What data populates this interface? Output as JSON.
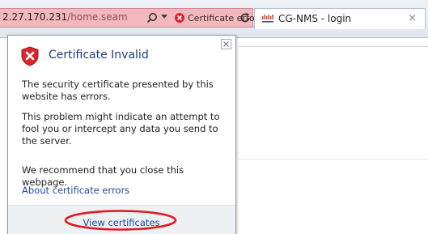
{
  "browser": {
    "url_host": "2.27.170.231",
    "url_path": "/home.seam",
    "cert_error_label": "Certificate error",
    "tab_title": "CG-NMS - login",
    "tab_close": "×"
  },
  "popup": {
    "title": "Certificate Invalid",
    "paragraph1": "The security certificate presented by this website has errors.",
    "paragraph2": "This problem might indicate an attempt to fool you or intercept any data you send to the server.",
    "paragraph3": "We recommend that you close this webpage.",
    "link_about": "About certificate errors",
    "button_view": "View certificates",
    "close_symbol": "×"
  },
  "colors": {
    "error_red": "#d7262e",
    "link_blue": "#1f4aa8",
    "address_bar_error": "#f3b8bd"
  },
  "icons": {
    "search": "search-icon",
    "dropdown": "chevron-down-icon",
    "error": "error-x-icon",
    "refresh": "refresh-icon",
    "tab_favicon": "cisco-logo-icon",
    "shield": "shield-error-icon"
  }
}
